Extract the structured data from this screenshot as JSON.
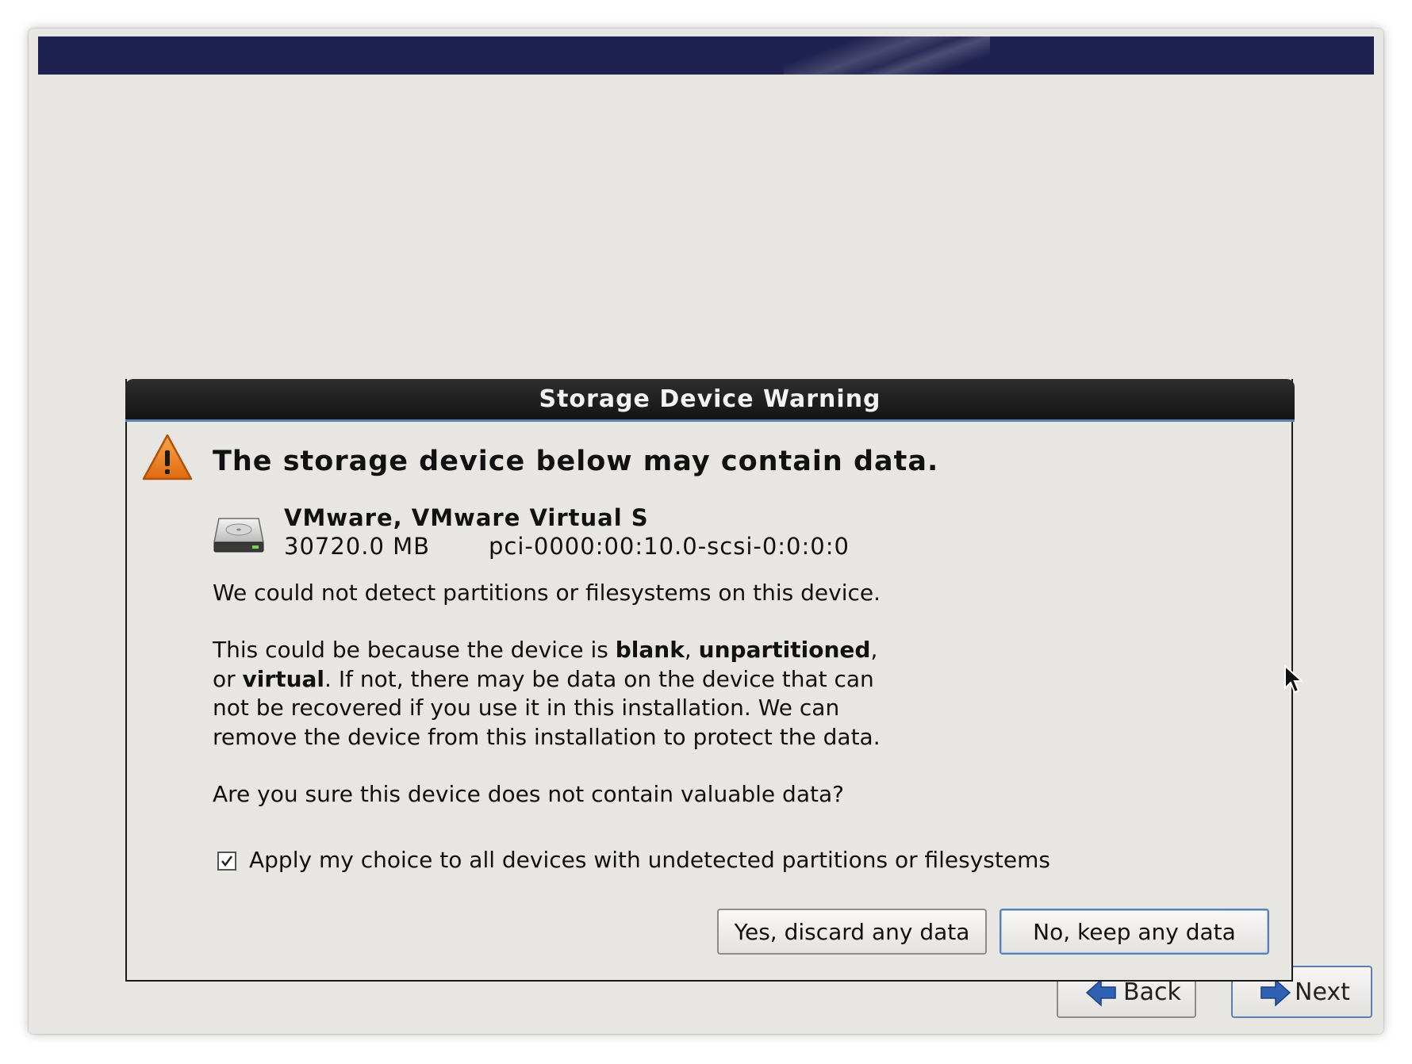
{
  "window": {
    "banner_color": "#1f2150",
    "background_color": "#e8e6e3"
  },
  "nav": {
    "back_label": "Back",
    "next_label": "Next"
  },
  "dialog": {
    "title": "Storage Device Warning",
    "headline": "The storage device below may contain data.",
    "device": {
      "name": "VMware, VMware Virtual S",
      "size": "30720.0 MB",
      "path": "pci-0000:00:10.0-scsi-0:0:0:0"
    },
    "paragraph1": "We could not detect partitions or filesystems on this device.",
    "paragraph2": {
      "l1_a": "This could be because the device is ",
      "l1_b": "blank",
      "l1_c": ", ",
      "l1_d": "unpartitioned",
      "l1_e": ",",
      "l2_a": "or ",
      "l2_b": "virtual",
      "l2_c": ". If not, there may be data on the device that can",
      "l3": "not be recovered if you use it in this installation. We can",
      "l4": "remove the device from this installation to protect the data."
    },
    "question": "Are you sure this device does not contain valuable data?",
    "apply_all": {
      "checked": true,
      "label": "Apply my choice to all devices with undetected partitions or filesystems"
    },
    "buttons": {
      "yes_label": "Yes, discard any data",
      "no_label": "No, keep any data"
    },
    "icons": [
      "warning-icon",
      "hard-disk-icon",
      "checkmark-icon",
      "back-arrow-icon",
      "next-arrow-icon",
      "mouse-cursor-icon"
    ]
  }
}
